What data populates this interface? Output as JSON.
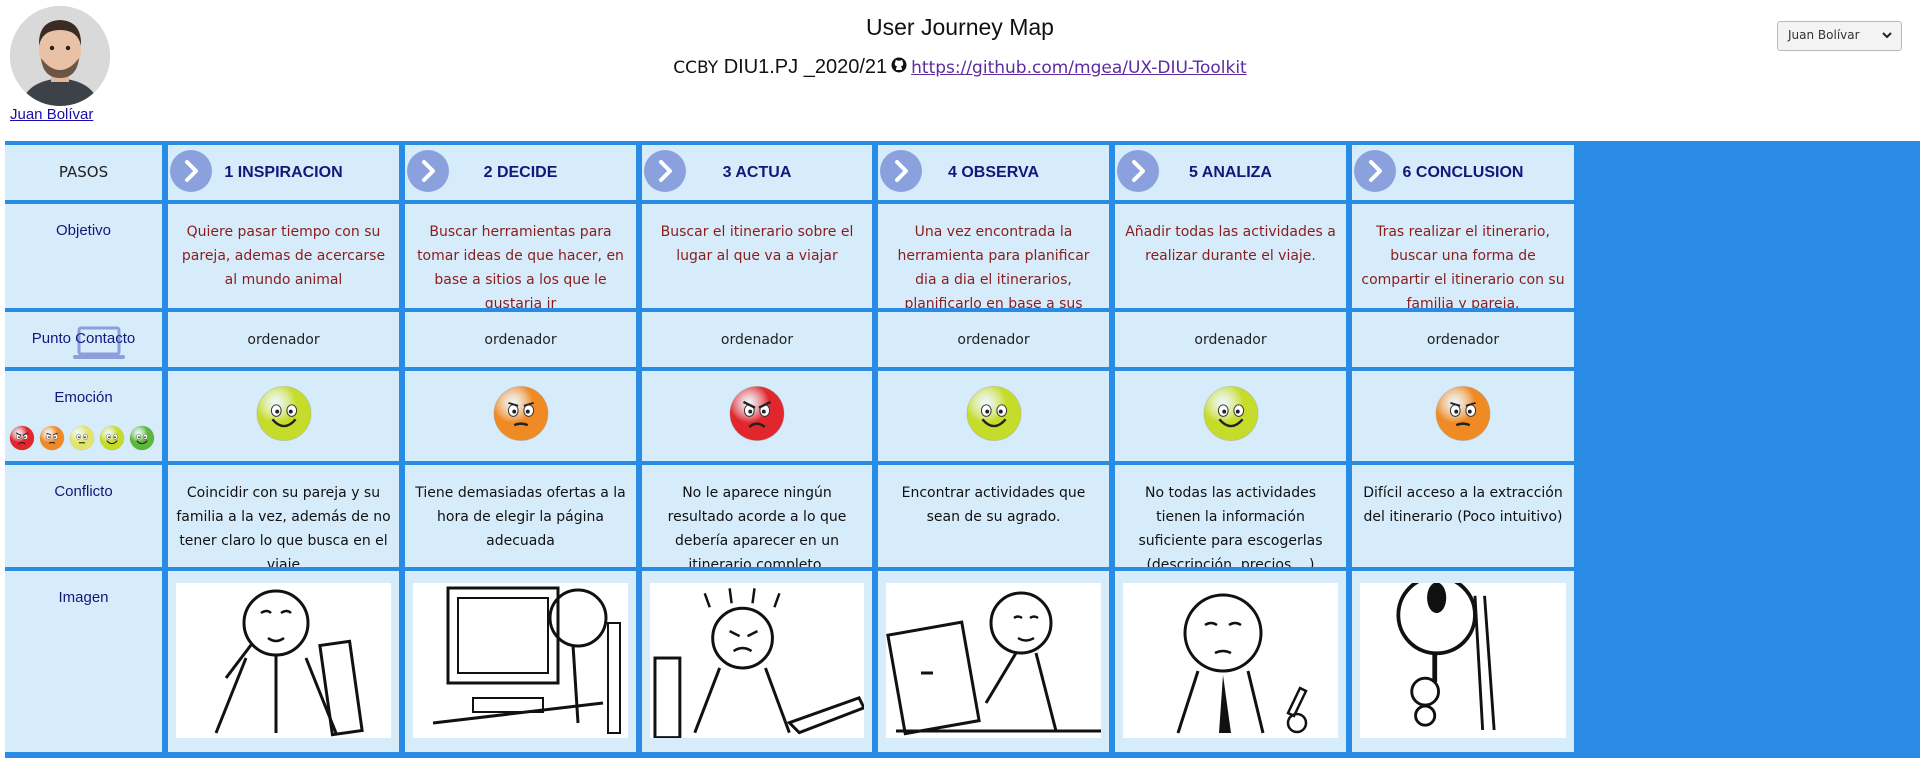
{
  "header": {
    "title": "User Journey Map",
    "license_prefix": "CCBY",
    "course_code": "DIU1.PJ _2020/21",
    "repo_url": "https://github.com/mgea/UX-DIU-Toolkit"
  },
  "persona": {
    "name": "Juan Bolívar",
    "selected": "Juan Bolívar"
  },
  "rows": {
    "steps": "PASOS",
    "objective": "Objetivo",
    "touchpoint": "Punto Contacto",
    "emotion": "Emoción",
    "conflict": "Conflicto",
    "image": "Imagen"
  },
  "steps": [
    {
      "title": "1 INSPIRACION",
      "objective": "Quiere pasar tiempo con su pareja, ademas de acercarse al mundo animal",
      "touchpoint": "ordenador",
      "emotion": "happy",
      "conflict": "Coincidir con su pareja y su familia a la vez, además de no tener claro lo que busca en el viaje",
      "image_icon": "person-thinking-drawing"
    },
    {
      "title": "2 DECIDE",
      "objective": "Buscar herramientas para tomar ideas de que hacer, en base a sitios a los que le gustaria ir",
      "touchpoint": "ordenador",
      "emotion": "annoyed",
      "conflict": "Tiene demasiadas ofertas a la hora de elegir la página adecuada",
      "image_icon": "person-at-computer-drawing"
    },
    {
      "title": "3 ACTUA",
      "objective": "Buscar el itinerario sobre el lugar al que va a viajar",
      "touchpoint": "ordenador",
      "emotion": "angry",
      "conflict": "No le aparece ningún resultado acorde a lo que debería aparecer en un itinerario completo.",
      "image_icon": "frustrated-person-laptop-drawing"
    },
    {
      "title": "4 OBSERVA",
      "objective": "Una vez encontrada la herramienta para planificar dia a dia el itinerarios, planificarlo en base a sus gustos.",
      "touchpoint": "ordenador",
      "emotion": "happy",
      "conflict": "Encontrar actividades que sean de su agrado.",
      "image_icon": "person-typing-laptop-drawing"
    },
    {
      "title": "5 ANALIZA",
      "objective": "Añadir todas las actividades a realizar durante el viaje.",
      "touchpoint": "ordenador",
      "emotion": "happy",
      "conflict": "No todas las actividades tienen la información suficiente para escogerlas (descripción, precios....)",
      "image_icon": "person-pondering-drawing"
    },
    {
      "title": "6 CONCLUSION",
      "objective": "Tras realizar el itinerario, buscar una forma de compartir el itinerario con su familia y pareja.",
      "touchpoint": "ordenador",
      "emotion": "annoyed",
      "conflict": "Difícil acceso a la extracción del itinerario (Poco intuitivo)",
      "image_icon": "person-magnifying-glass-drawing"
    }
  ],
  "emotion_scale": [
    "angry",
    "annoyed",
    "neutral",
    "happy",
    "very-happy"
  ],
  "colors": {
    "border": "#2a8be4",
    "cell": "#d6ecfa",
    "label": "#10187a",
    "objective_text": "#8b1c1c",
    "arrow": "#8ba1de",
    "link": "#5b2ca0",
    "emotion_angry": "#e1262d",
    "emotion_annoyed": "#f08a24",
    "emotion_neutral": "#e3e46a",
    "emotion_happy": "#c6dc2b",
    "emotion_very_happy": "#5cb83a"
  }
}
